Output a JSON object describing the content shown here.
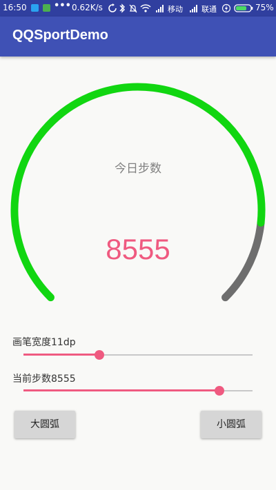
{
  "status_bar": {
    "time": "16:50",
    "dots": "•••",
    "network_speed": "0.62K/s",
    "carrier_1": "移动",
    "carrier_2": "联通",
    "battery": "75%",
    "battery_level": 0.75,
    "icons": [
      "qq-notification-icon",
      "battery-saver-icon",
      "sync-icon",
      "bluetooth-icon",
      "alarm-off-icon",
      "wifi-icon",
      "signal-icon",
      "charging-icon",
      "battery-icon"
    ]
  },
  "app_bar": {
    "title": "QQSportDemo"
  },
  "gauge": {
    "label": "今日步数",
    "value": "8555",
    "progress_fraction": 0.855,
    "progress_color": "#11d611",
    "remaining_color": "#6e6e6e"
  },
  "controls": {
    "stroke_width_label": "画笔宽度11dp",
    "stroke_width_fraction": 0.33,
    "steps_label": "当前步数8555",
    "steps_fraction": 0.855,
    "accent_color": "#ef5a80"
  },
  "buttons": {
    "big_arc": "大圆弧",
    "small_arc": "小圆弧"
  }
}
